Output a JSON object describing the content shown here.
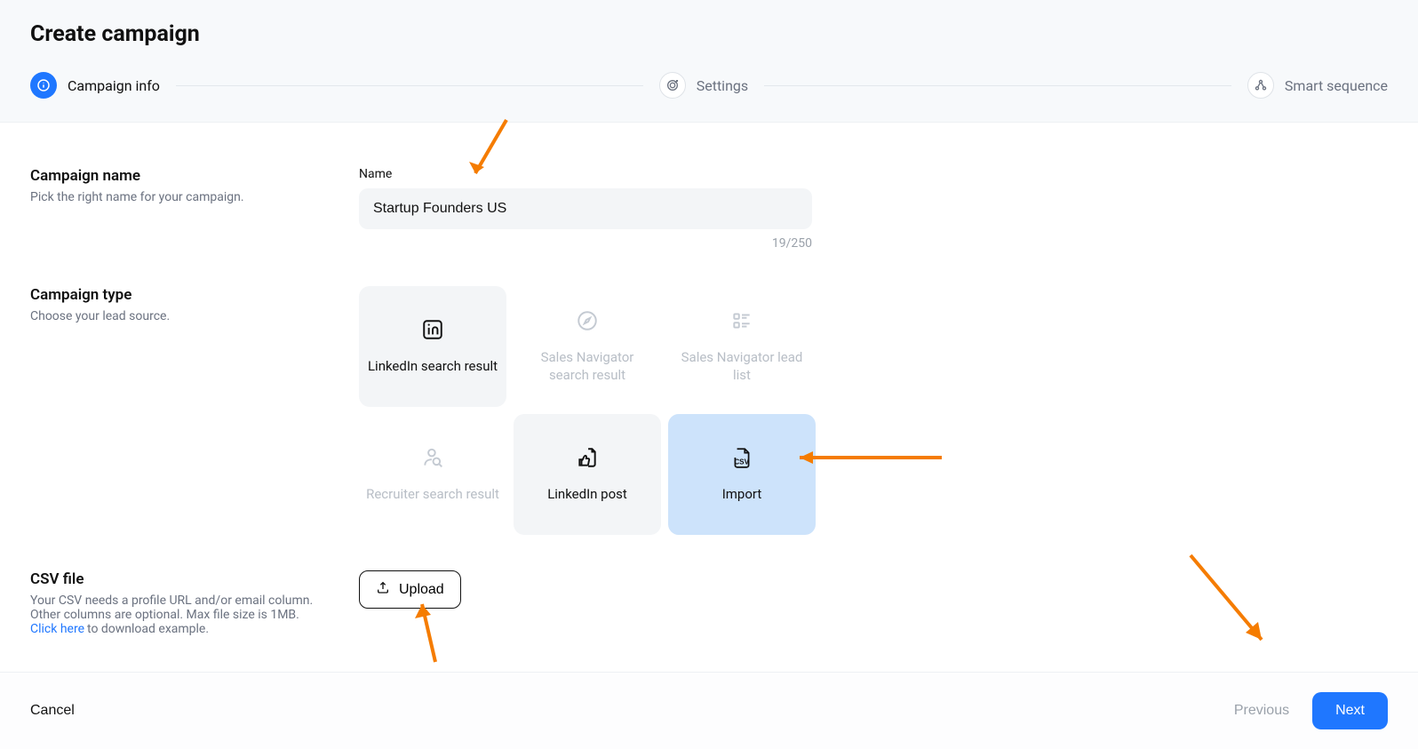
{
  "page": {
    "title": "Create campaign"
  },
  "stepper": {
    "steps": [
      {
        "label": "Campaign info",
        "active": true
      },
      {
        "label": "Settings",
        "active": false
      },
      {
        "label": "Smart sequence",
        "active": false
      }
    ]
  },
  "campaign_name_section": {
    "title": "Campaign name",
    "subtitle": "Pick the right name for your campaign.",
    "field_label": "Name",
    "value": "Startup Founders US",
    "counter": "19/250"
  },
  "campaign_type_section": {
    "title": "Campaign type",
    "subtitle": "Choose your lead source.",
    "cards": [
      {
        "label": "LinkedIn search result",
        "state": "light"
      },
      {
        "label": "Sales Navigator search result",
        "state": "dimmed"
      },
      {
        "label": "Sales Navigator lead list",
        "state": "dimmed"
      },
      {
        "label": "Recruiter search result",
        "state": "dimmed"
      },
      {
        "label": "LinkedIn post",
        "state": "light"
      },
      {
        "label": "Import",
        "state": "selected"
      }
    ]
  },
  "csv_section": {
    "title": "CSV file",
    "subtitle_line1": "Your CSV needs a profile URL and/or email column. Other columns are optional. Max file size is 1MB.",
    "link_text": "Click here",
    "link_after": "to download example.",
    "upload_label": "Upload"
  },
  "footer": {
    "cancel": "Cancel",
    "previous": "Previous",
    "next": "Next"
  }
}
